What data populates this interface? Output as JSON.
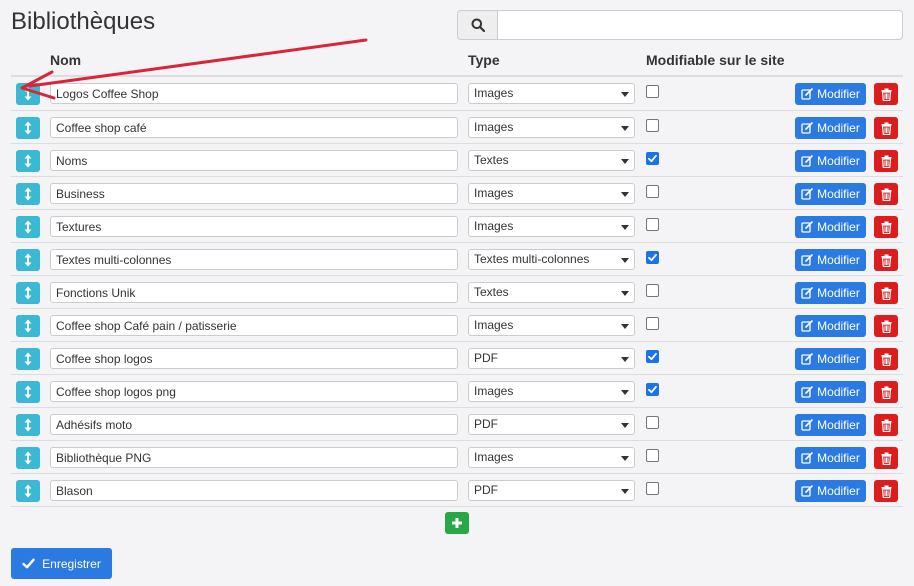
{
  "page": {
    "title": "Bibliothèques"
  },
  "search": {
    "placeholder": "",
    "value": ""
  },
  "table": {
    "headers": {
      "name": "Nom",
      "type": "Type",
      "modifiable": "Modifiable sur le site"
    },
    "rows": [
      {
        "name": "Logos Coffee Shop",
        "type": "Images",
        "modifiable": false
      },
      {
        "name": "Coffee shop café",
        "type": "Images",
        "modifiable": false
      },
      {
        "name": "Noms",
        "type": "Textes",
        "modifiable": true
      },
      {
        "name": "Business",
        "type": "Images",
        "modifiable": false
      },
      {
        "name": "Textures",
        "type": "Images",
        "modifiable": false
      },
      {
        "name": "Textes multi-colonnes",
        "type": "Textes multi-colonnes",
        "modifiable": true
      },
      {
        "name": "Fonctions Unik",
        "type": "Textes",
        "modifiable": false
      },
      {
        "name": "Coffee shop Café pain / patisserie",
        "type": "Images",
        "modifiable": false
      },
      {
        "name": "Coffee shop logos",
        "type": "PDF",
        "modifiable": true
      },
      {
        "name": "Coffee shop logos png",
        "type": "Images",
        "modifiable": true
      },
      {
        "name": "Adhésifs moto",
        "type": "PDF",
        "modifiable": false
      },
      {
        "name": "Bibliothèque PNG",
        "type": "Images",
        "modifiable": false
      },
      {
        "name": "Blason",
        "type": "PDF",
        "modifiable": false
      }
    ]
  },
  "actions": {
    "modify_label": "Modifier",
    "save_label": "Enregistrer"
  },
  "colors": {
    "move": "#3bb8d3",
    "modify": "#2a7ae2",
    "delete": "#dc1d1d",
    "add": "#28a745",
    "save": "#2a7ae2",
    "annotation_arrow": "#d9253a"
  },
  "icons": {
    "search": "search-icon",
    "move": "vertical-arrows-icon",
    "modify": "edit-icon",
    "delete": "trash-icon",
    "add": "plus-icon",
    "save": "checkmark-icon"
  }
}
